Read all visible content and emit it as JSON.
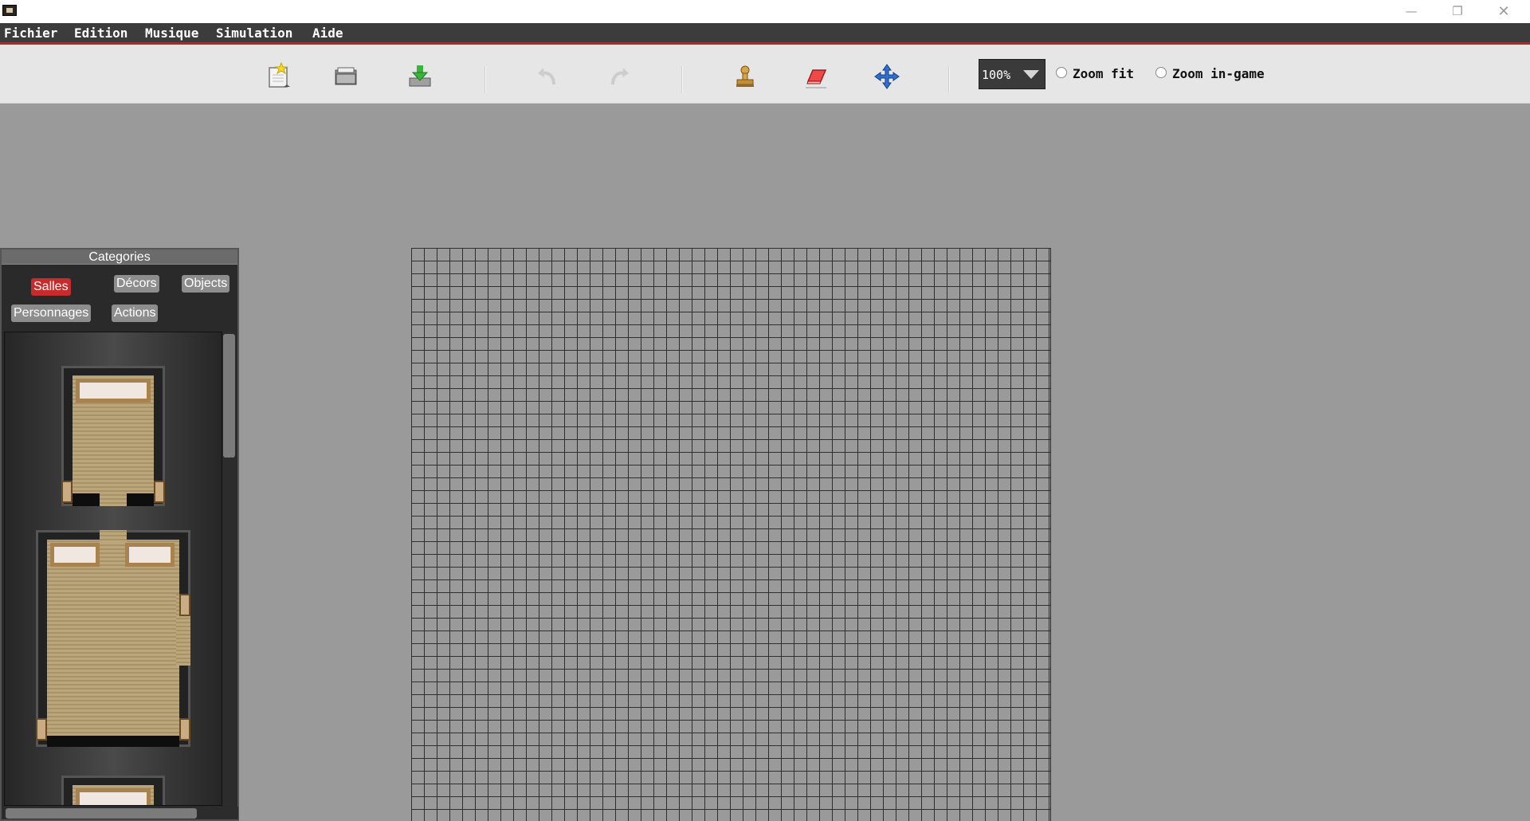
{
  "window": {
    "minimize_glyph": "—",
    "maximize_glyph": "❐",
    "close_glyph": "✕"
  },
  "menu": {
    "items": [
      "Fichier",
      "Edition",
      "Musique",
      "Simulation",
      "Aide"
    ]
  },
  "toolbar": {
    "buttons": [
      {
        "name": "new-map",
        "icon": "new-document-star-icon",
        "enabled": true
      },
      {
        "name": "open",
        "icon": "folder-open-icon",
        "enabled": true
      },
      {
        "name": "save",
        "icon": "save-download-icon",
        "enabled": true
      },
      {
        "name": "undo",
        "icon": "undo-arrow-icon",
        "enabled": false
      },
      {
        "name": "redo",
        "icon": "redo-arrow-icon",
        "enabled": false
      },
      {
        "name": "stamp",
        "icon": "stamp-icon",
        "enabled": true
      },
      {
        "name": "eraser",
        "icon": "eraser-icon",
        "enabled": true
      },
      {
        "name": "move",
        "icon": "move-arrows-icon",
        "enabled": true
      }
    ],
    "zoom": {
      "value": "100%",
      "options_selected": "100%"
    },
    "zoom_fit_label": "Zoom fit",
    "zoom_ingame_label": "Zoom in-game",
    "zoom_fit_checked": false,
    "zoom_ingame_checked": false
  },
  "panel": {
    "title": "Categories",
    "categories": [
      {
        "label": "Salles",
        "active": true
      },
      {
        "label": "Décors",
        "active": false
      },
      {
        "label": "Objects",
        "active": false
      },
      {
        "label": "Personnages",
        "active": false
      },
      {
        "label": "Actions",
        "active": false
      }
    ],
    "tiles": [
      "room-tile-single-bed",
      "room-tile-double-bed",
      "room-tile-single-bed-partial"
    ]
  },
  "colors": {
    "menu_bg": "#3c3c3c",
    "menu_accent": "#c81e1e",
    "active_category": "#c72b2b",
    "canvas_bg": "#9a9a9a",
    "grid_line": "#2e2e2e"
  }
}
